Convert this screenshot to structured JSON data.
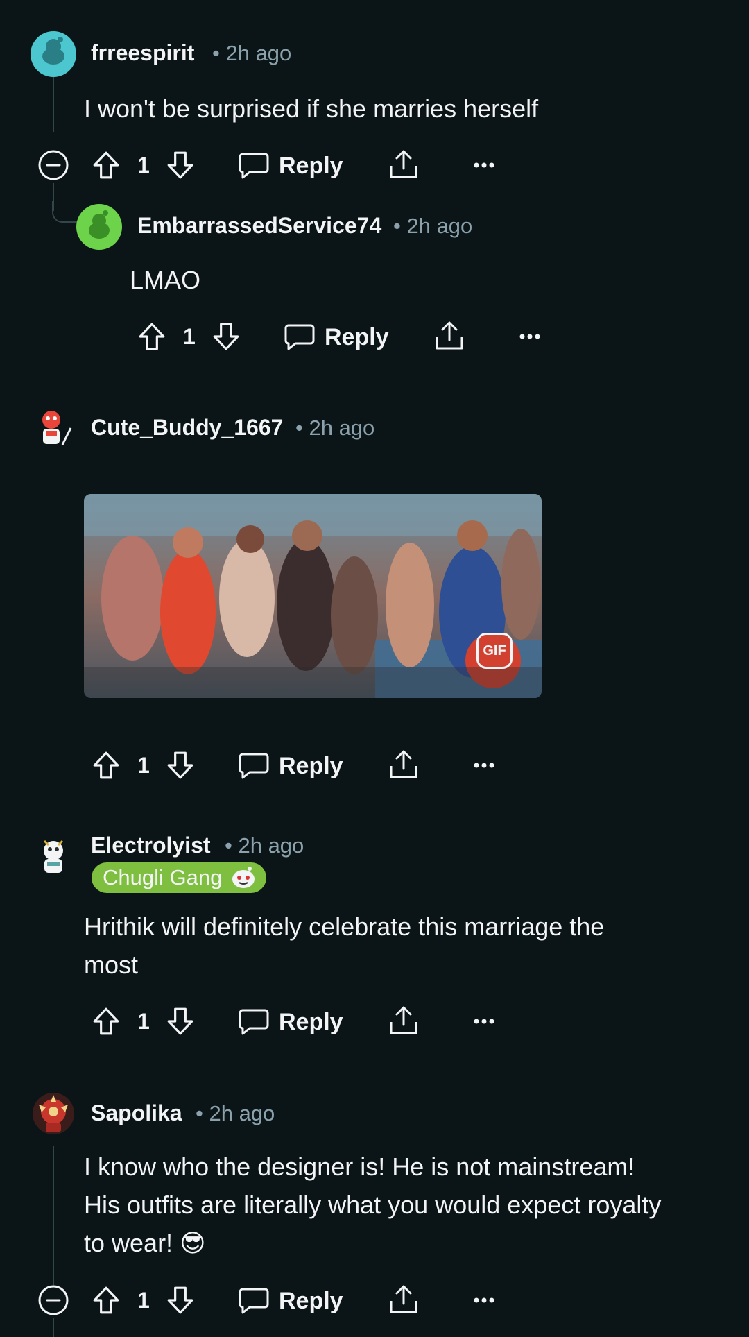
{
  "comments": [
    {
      "username": "frreespirit",
      "time": "2h ago",
      "text": "I won't be surprised if she marries herself",
      "votes": "1",
      "reply_label": "Reply",
      "avatar_color": "#4dc7cf"
    },
    {
      "username": "EmbarrassedService74",
      "time": "2h ago",
      "text": "LMAO",
      "votes": "1",
      "reply_label": "Reply",
      "avatar_color": "#6dd34b"
    },
    {
      "username": "Cute_Buddy_1667",
      "time": "2h ago",
      "gif_badge": "GIF",
      "votes": "1",
      "reply_label": "Reply"
    },
    {
      "username": "Electrolyist",
      "time": "2h ago",
      "flair": "Chugli Gang",
      "text_line1": "Hrithik will definitely celebrate this marriage the",
      "text_line2": "most",
      "votes": "1",
      "reply_label": "Reply"
    },
    {
      "username": "Sapolika",
      "time": "2h ago",
      "text_line1": "I know who the designer is! He is not mainstream!",
      "text_line2": "His outfits are literally what you would expect royalty",
      "text_line3": "to wear! 😎",
      "votes": "1",
      "reply_label": "Reply"
    }
  ],
  "colors": {
    "background": "#0b1416",
    "text": "#f2f4f5",
    "meta": "#8ba2ad",
    "thread_line": "#33464c",
    "flair_bg": "#7fbf3f"
  }
}
